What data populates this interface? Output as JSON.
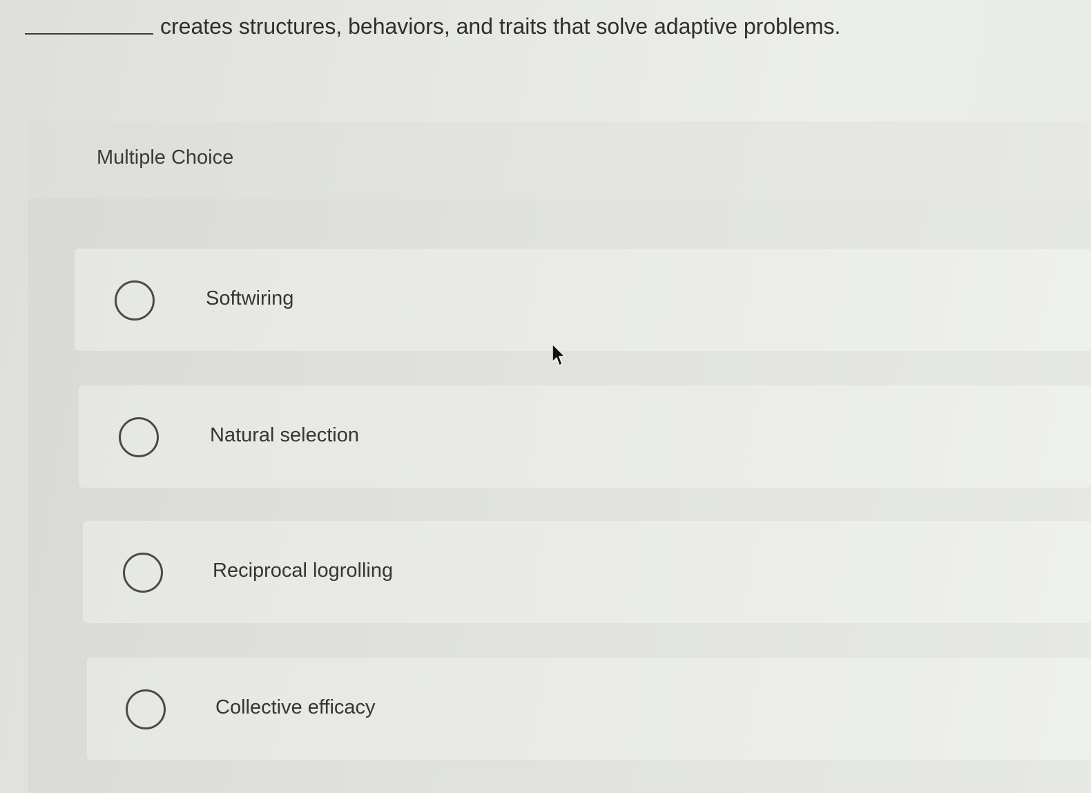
{
  "question": {
    "text": "creates structures, behaviors, and traits that solve adaptive problems."
  },
  "multiple_choice": {
    "title": "Multiple Choice",
    "options": [
      {
        "label": "Softwiring",
        "selected": false
      },
      {
        "label": "Natural selection",
        "selected": false
      },
      {
        "label": "Reciprocal logrolling",
        "selected": false
      },
      {
        "label": "Collective efficacy",
        "selected": false
      }
    ]
  },
  "icons": {
    "radio": "radio-button-unchecked-icon",
    "cursor": "mouse-pointer-icon"
  },
  "colors": {
    "text": "#2e2e2e",
    "radio_border": "#4a4a4a",
    "panel_bg": "#e0e1dd"
  }
}
